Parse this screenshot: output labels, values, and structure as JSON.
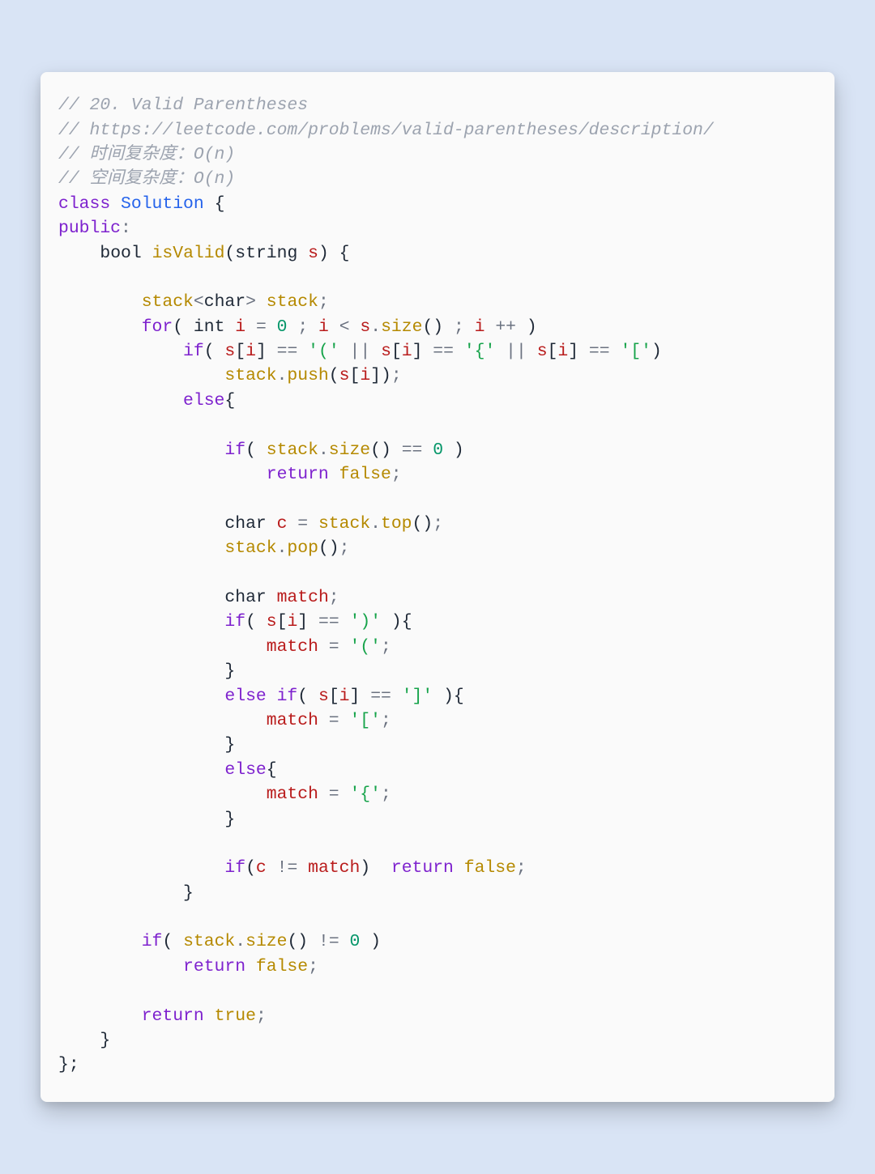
{
  "code": {
    "comment1": "// 20. Valid Parentheses",
    "comment2": "// https://leetcode.com/problems/valid-parentheses/description/",
    "comment3": "// 时间复杂度：O(n)",
    "comment4": "// 空间复杂度：O(n)",
    "kw_class": "class",
    "cls_name": "Solution",
    "brace_open": "{",
    "kw_public": "public",
    "colon": ":",
    "t_bool": "bool",
    "fn_isValid": "isValid",
    "paren_open": "(",
    "t_string": "string",
    "var_s": "s",
    "paren_close": ")",
    "space": " ",
    "fn_stack": "stack",
    "lt": "<",
    "t_char": "char",
    "gt": ">",
    "id_stack": "stack",
    "semi": ";",
    "kw_for": "for",
    "t_int": "int",
    "var_i": "i",
    "eq": "=",
    "num0": "0",
    "lt_op": "<",
    "dot": ".",
    "fn_size": "size",
    "empty_parens": "()",
    "plusplus": "++",
    "kw_if": "if",
    "sq_open": "[",
    "sq_close": "]",
    "eqeq": "==",
    "str_lparen": "'('",
    "oror": "||",
    "str_lbrace": "'{'",
    "str_lbracket": "'['",
    "fn_push": "push",
    "kw_else": "else",
    "kw_return": "return",
    "bool_false": "false",
    "var_c": "c",
    "fn_top": "top",
    "fn_pop": "pop",
    "var_match": "match",
    "str_rparen": "')'",
    "str_rbracket": "']'",
    "str_rbrace_match": "'{'",
    "neq": "!=",
    "bool_true": "true",
    "brace_close": "}",
    "brace_close_semi": "};"
  }
}
